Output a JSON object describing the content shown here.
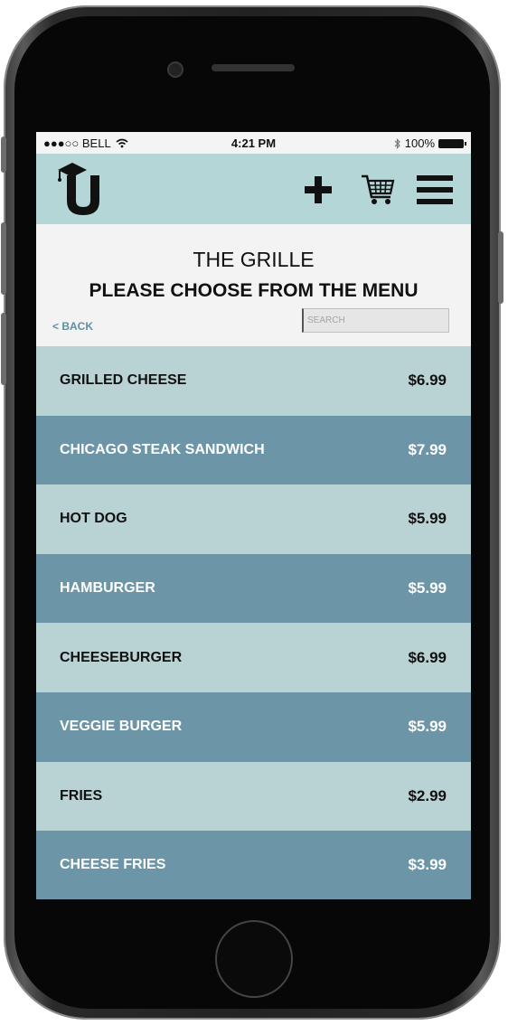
{
  "status_bar": {
    "carrier": "●●●○○ BELL",
    "time": "4:21 PM",
    "battery": "100%"
  },
  "app_bar": {
    "logo_icon": "graduation-cap-u-logo",
    "add_icon": "plus-icon",
    "cart_icon": "shopping-cart-icon",
    "menu_icon": "hamburger-menu-icon",
    "background_color": "#b4d6d6"
  },
  "header": {
    "title": "THE GRILLE",
    "subtitle": "PLEASE CHOOSE FROM THE MENU",
    "back_label": "< BACK",
    "search_placeholder": "SEARCH"
  },
  "menu": {
    "items": [
      {
        "name": "GRILLED CHEESE",
        "price": "$6.99"
      },
      {
        "name": "CHICAGO STEAK SANDWICH",
        "price": "$7.99"
      },
      {
        "name": "HOT DOG",
        "price": "$5.99"
      },
      {
        "name": "HAMBURGER",
        "price": "$5.99"
      },
      {
        "name": "CHEESEBURGER",
        "price": "$6.99"
      },
      {
        "name": "VEGGIE BURGER",
        "price": "$5.99"
      },
      {
        "name": "FRIES",
        "price": "$2.99"
      },
      {
        "name": "CHEESE FRIES",
        "price": "$3.99"
      }
    ],
    "light_color": "#b9d3d5",
    "dark_color": "#6c96a8"
  }
}
